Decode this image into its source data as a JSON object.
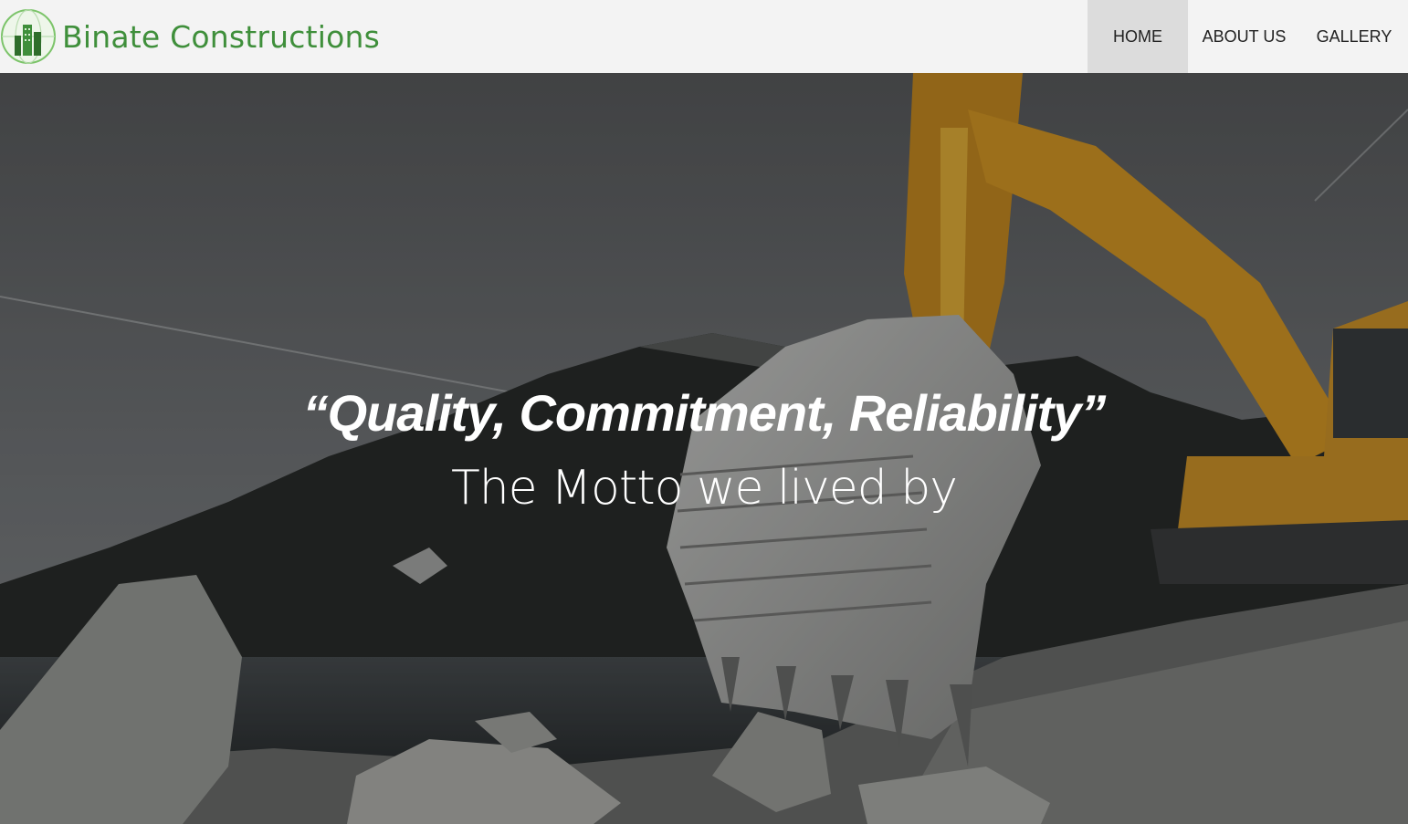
{
  "brand": {
    "name": "Binate Constructions",
    "logo_icon": "building-globe-logo",
    "color": "#3f8f3b"
  },
  "nav": {
    "items": [
      {
        "label": "HOME",
        "active": true
      },
      {
        "label": "ABOUT US",
        "active": false
      },
      {
        "label": "GALLERY",
        "active": false
      }
    ]
  },
  "hero": {
    "motto": "“Quality, Commitment, Reliability”",
    "tagline": "The Motto we lived by",
    "background": "excavator-bucket-on-rocky-riverbank-photo"
  }
}
